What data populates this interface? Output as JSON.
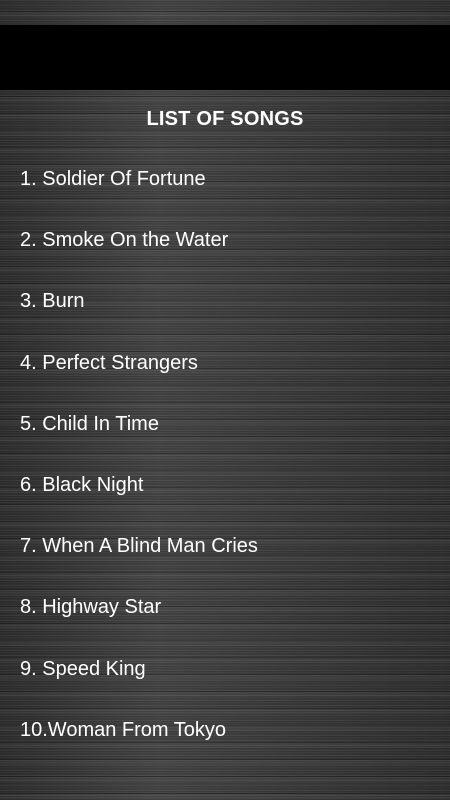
{
  "title": "LIST OF SONGS",
  "songs": [
    {
      "label": "1. Soldier Of Fortune"
    },
    {
      "label": "2. Smoke On the Water"
    },
    {
      "label": "3. Burn"
    },
    {
      "label": "4. Perfect Strangers"
    },
    {
      "label": "5. Child In Time"
    },
    {
      "label": "6. Black Night"
    },
    {
      "label": "7. When A Blind Man Cries"
    },
    {
      "label": "8. Highway Star"
    },
    {
      "label": "9. Speed King"
    },
    {
      "label": "10.Woman From Tokyo"
    }
  ],
  "colors": {
    "top_bar": "#000000",
    "text": "#ffffff",
    "background": "#3a3a3a"
  }
}
